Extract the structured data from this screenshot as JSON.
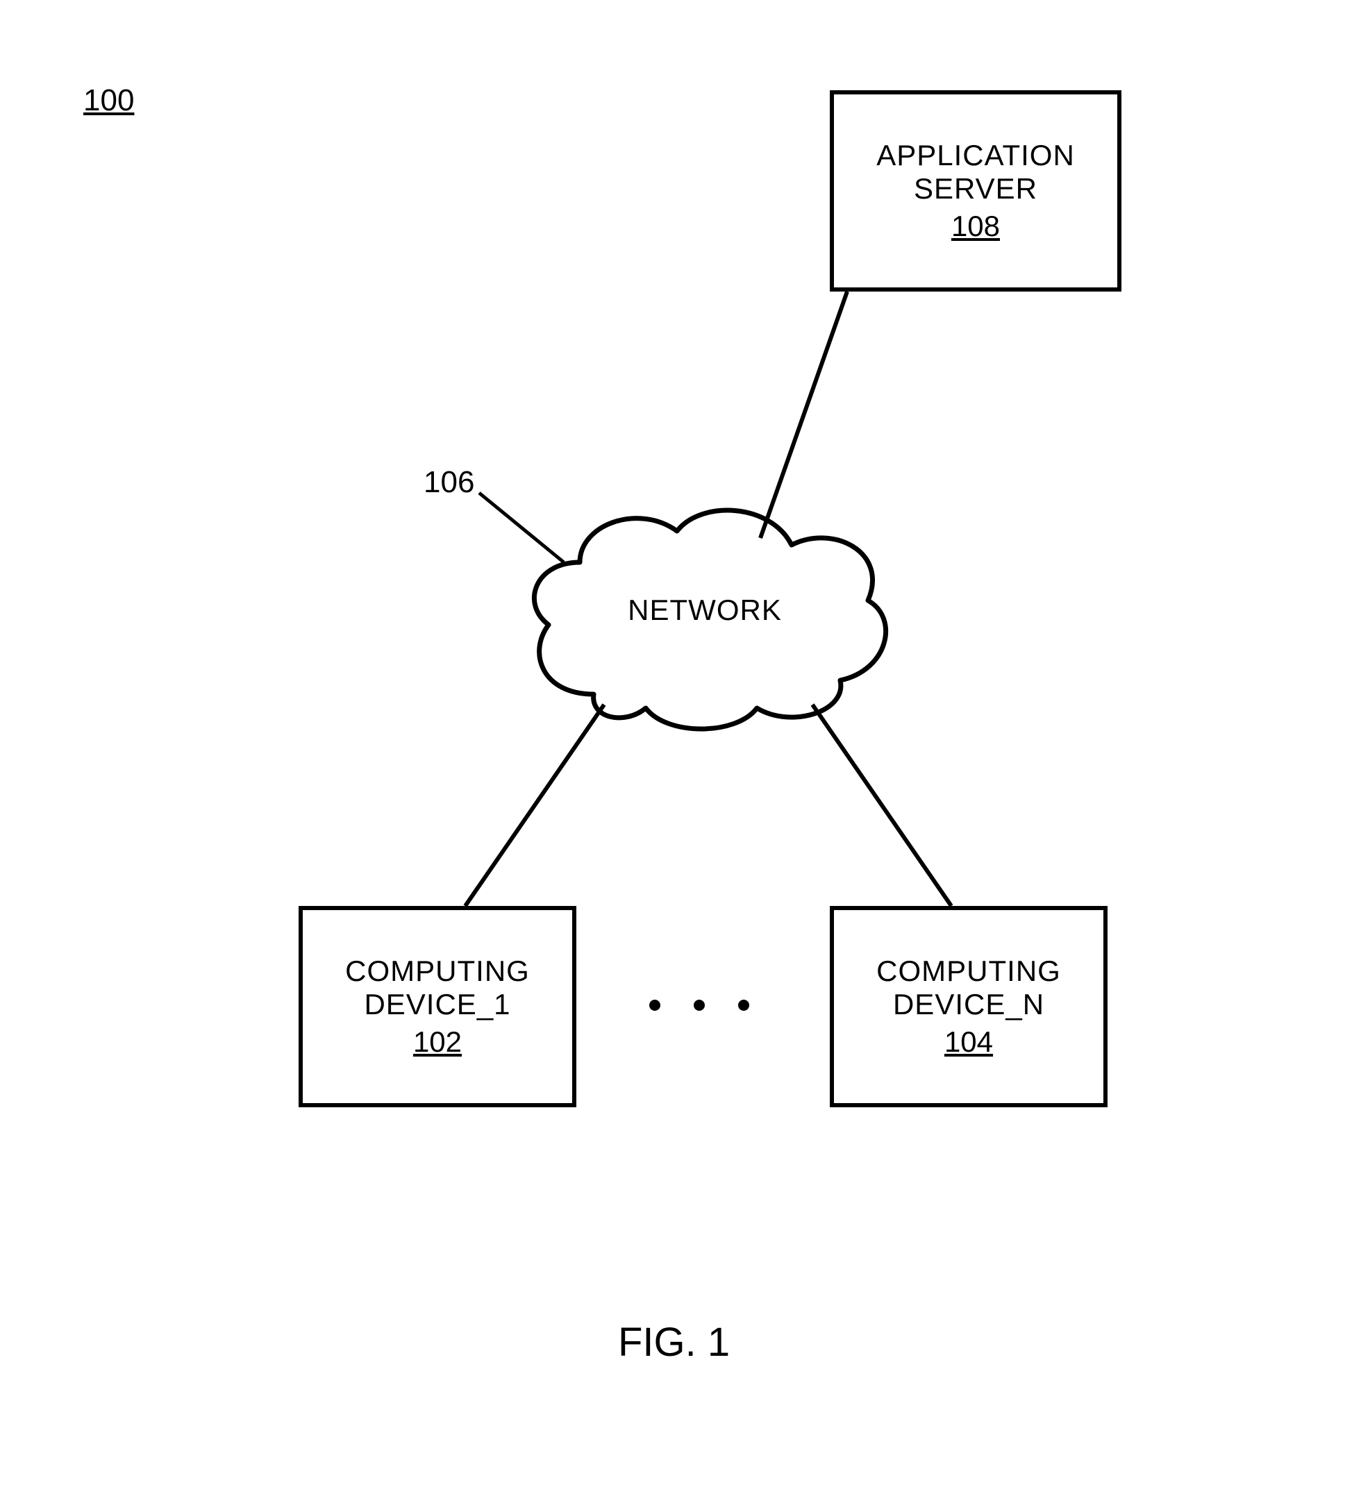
{
  "figure": {
    "system_ref": "100",
    "caption": "FIG. 1"
  },
  "network": {
    "label": "NETWORK",
    "ref": "106"
  },
  "boxes": {
    "app_server": {
      "line1": "APPLICATION",
      "line2": "SERVER",
      "ref": "108"
    },
    "device1": {
      "line1": "COMPUTING",
      "line2": "DEVICE_1",
      "ref": "102"
    },
    "deviceN": {
      "line1": "COMPUTING",
      "line2": "DEVICE_N",
      "ref": "104"
    }
  }
}
